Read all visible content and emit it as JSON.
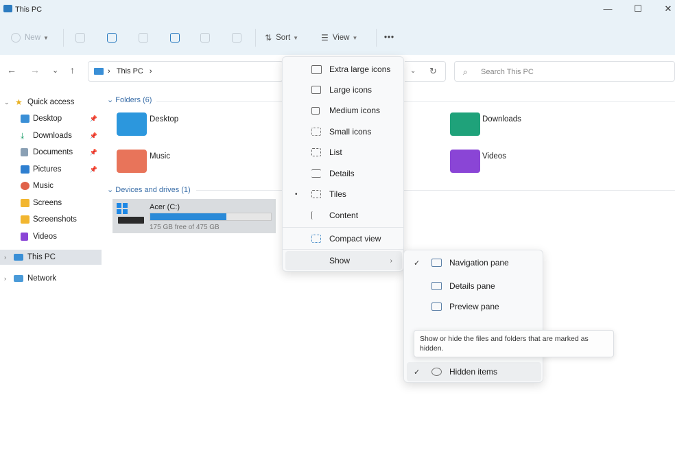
{
  "window": {
    "title": "This PC",
    "minimize": "—",
    "maximize": "☐",
    "close": "✕"
  },
  "toolbar": {
    "new_label": "New",
    "sort_label": "Sort",
    "view_label": "View",
    "more_label": "•••"
  },
  "nav": {
    "back": "←",
    "forward": "→",
    "recent": "⌄",
    "up": "↑",
    "path": "This PC",
    "path_sep": "›",
    "refresh": "↻",
    "search_placeholder": "Search This PC"
  },
  "sidebar": {
    "quick_access": "Quick access",
    "items": [
      {
        "label": "Desktop",
        "pinned": true,
        "color": "#3a8fd6"
      },
      {
        "label": "Downloads",
        "pinned": true,
        "color": "#1f9e6b"
      },
      {
        "label": "Documents",
        "pinned": true,
        "color": "#7a8b9c"
      },
      {
        "label": "Pictures",
        "pinned": true,
        "color": "#2e7fd0"
      },
      {
        "label": "Music",
        "pinned": false,
        "color": "#e0624a"
      },
      {
        "label": "Screens",
        "pinned": false,
        "color": "#f2b630"
      },
      {
        "label": "Screenshots",
        "pinned": false,
        "color": "#f2b630"
      },
      {
        "label": "Videos",
        "pinned": false,
        "color": "#8a45d6"
      }
    ],
    "this_pc": "This PC",
    "network": "Network"
  },
  "content": {
    "folders_header": "Folders (6)",
    "folders": [
      {
        "label": "Desktop",
        "color": "#2c97dd"
      },
      {
        "label": "Downloads",
        "color": "#1fa27a"
      },
      {
        "label": "Music",
        "color": "#e8745a"
      },
      {
        "label": "Videos",
        "color": "#8a45d6"
      }
    ],
    "devices_header": "Devices and drives (1)",
    "drive": {
      "name": "Acer (C:)",
      "free": "175 GB free of 475 GB",
      "used_fraction": 0.63
    }
  },
  "view_menu": {
    "items": [
      {
        "label": "Extra large icons"
      },
      {
        "label": "Large icons"
      },
      {
        "label": "Medium icons"
      },
      {
        "label": "Small icons"
      },
      {
        "label": "List"
      },
      {
        "label": "Details"
      },
      {
        "label": "Tiles",
        "selected": true
      },
      {
        "label": "Content"
      },
      {
        "label": "Compact view"
      },
      {
        "label": "Show",
        "submenu": true
      }
    ],
    "selected_mark": "•",
    "submenu_arrow": "›"
  },
  "show_menu": {
    "items": [
      {
        "label": "Navigation pane",
        "checked": true
      },
      {
        "label": "Details pane",
        "checked": false
      },
      {
        "label": "Preview pane",
        "checked": false
      },
      {
        "label": "Hidden items",
        "checked": true
      }
    ],
    "check_mark": "✓"
  },
  "tooltip": "Show or hide the files and folders that are marked as hidden."
}
